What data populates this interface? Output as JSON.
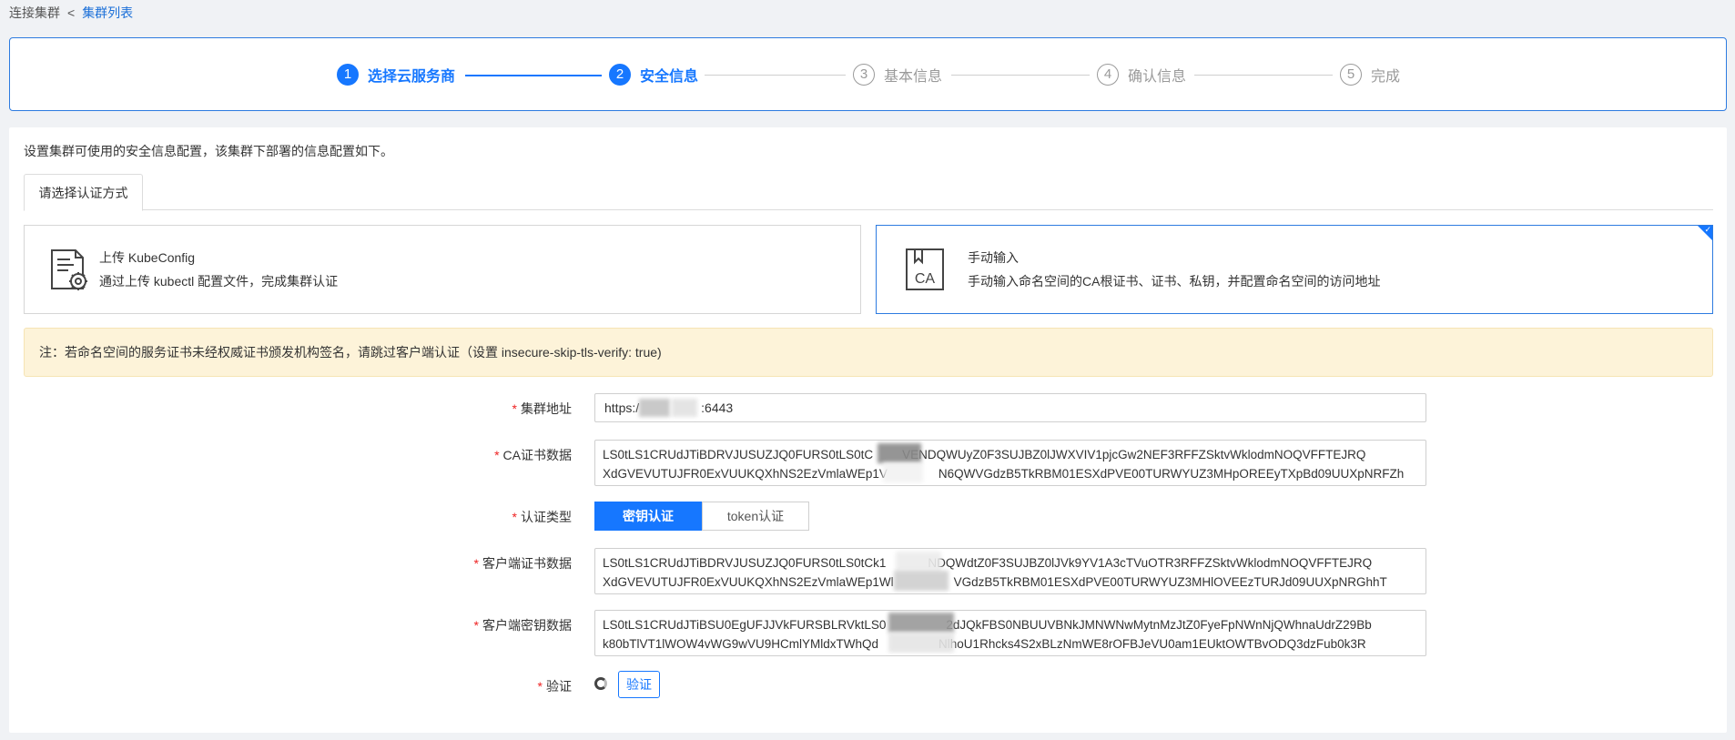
{
  "breadcrumb": {
    "parent": "连接集群",
    "separator": "<",
    "current": "集群列表"
  },
  "steps": [
    {
      "num": "1",
      "label": "选择云服务商",
      "state": "done"
    },
    {
      "num": "2",
      "label": "安全信息",
      "state": "active"
    },
    {
      "num": "3",
      "label": "基本信息",
      "state": "pending"
    },
    {
      "num": "4",
      "label": "确认信息",
      "state": "pending"
    },
    {
      "num": "5",
      "label": "完成",
      "state": "pending"
    }
  ],
  "description": "设置集群可使用的安全信息配置，该集群下部署的信息配置如下。",
  "tab_label": "请选择认证方式",
  "auth_options": [
    {
      "title": "上传 KubeConfig",
      "subtitle": "通过上传 kubectl 配置文件，完成集群认证",
      "icon": "file-config-icon",
      "selected": false
    },
    {
      "title": "手动输入",
      "subtitle": "手动输入命名空间的CA根证书、证书、私钥，并配置命名空间的访问地址",
      "icon": "ca-certificate-icon",
      "icon_text": "CA",
      "selected": true
    }
  ],
  "notice": "注：若命名空间的服务证书未经权威证书颁发机构签名，请跳过客户端认证（设置 insecure-skip-tls-verify: true)",
  "form": {
    "cluster_address": {
      "label": "集群地址",
      "value_prefix": "https:/",
      "value_suffix": ":6443"
    },
    "ca_data": {
      "label": "CA证书数据",
      "line1_a": "LS0tLS1CRUdJTiBDRVJUSUZJQ0FURS0tLS0tC",
      "line1_b": "VENDQWUyZ0F3SUJBZ0lJWXVIV1pjcGw2NEF3RFFZSktvWklodmNOQVFFTEJRQ",
      "line2_a": "XdGVEVUTUJFR0ExVUUKQXhNS2EzVmlaWEp1V",
      "line2_b": "N6QWVGdzB5TkRBM01ESXdPVE00TURWYUZ3MHpOREEyTXpBd09UUXpNRFZh"
    },
    "auth_type": {
      "label": "认证类型",
      "options": [
        "密钥认证",
        "token认证"
      ],
      "selected": "密钥认证"
    },
    "client_cert": {
      "label": "客户端证书数据",
      "line1_a": "LS0tLS1CRUdJTiBDRVJUSUZJQ0FURS0tLS0tCk1",
      "line1_b": "NDQWdtZ0F3SUJBZ0lJVk9YV1A3cTVuOTR3RFFZSktvWklodmNOQVFFTEJRQ",
      "line2_a": "XdGVEVUTUJFR0ExVUUKQXhNS2EzVmlaWEp1Wl",
      "line2_b": "VGdzB5TkRBM01ESXdPVE00TURWYUZ3MHlOVEEzTURJd09UUXpNRGhhT"
    },
    "client_key": {
      "label": "客户端密钥数据",
      "line1_a": "LS0tLS1CRUdJTiBSU0EgUFJJVkFURSBLRVktLS0",
      "line1_b": "2dJQkFBS0NBUUVBNkJMNWNwMytnMzJtZ0FyeFpNWnNjQWhnaUdrZ29Bb",
      "line2_a": "k80bTlVT1lWOW4vWG9wVU9HCmlYMldxTWhQd",
      "line2_b": "NlhoU1Rhcks4S2xBLzNmWE8rOFBJeVU0am1EUktOWTBvODQ3dzFub0k3R"
    },
    "verify": {
      "label": "验证",
      "button": "验证"
    }
  }
}
